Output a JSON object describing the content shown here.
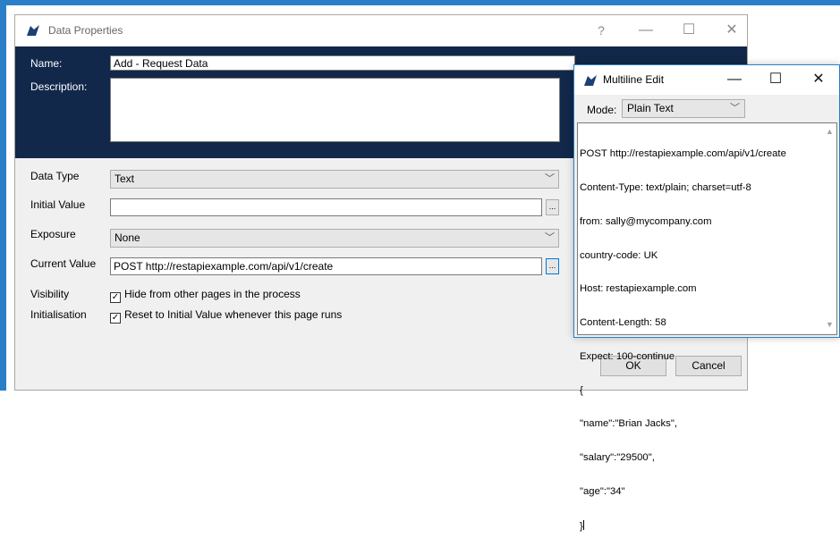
{
  "window": {
    "title": "Data Properties",
    "help_glyph": "?",
    "min_glyph": "—",
    "max_glyph": "☐",
    "close_glyph": "✕"
  },
  "header": {
    "name_label": "Name:",
    "name_value": "Add - Request Data",
    "description_label": "Description:",
    "description_value": ""
  },
  "form": {
    "data_type_label": "Data Type",
    "data_type_value": "Text",
    "initial_value_label": "Initial Value",
    "initial_value_value": "",
    "exposure_label": "Exposure",
    "exposure_value": "None",
    "current_value_label": "Current Value",
    "current_value_value": "POST http://restapiexample.com/api/v1/create",
    "ellipsis": "...",
    "visibility_label": "Visibility",
    "visibility_check": "Hide from other pages in the process",
    "initialisation_label": "Initialisation",
    "initialisation_check": "Reset to Initial Value whenever this page runs"
  },
  "buttons": {
    "ok": "OK",
    "cancel": "Cancel"
  },
  "multiline": {
    "title": "Multiline Edit",
    "min_glyph": "—",
    "max_glyph": "☐",
    "close_glyph": "✕",
    "mode_label": "Mode:",
    "mode_value": "Plain Text",
    "lines": [
      "POST http://restapiexample.com/api/v1/create",
      "Content-Type: text/plain; charset=utf-8",
      "from: sally@mycompany.com",
      "country-code: UK",
      "Host: restapiexample.com",
      "Content-Length: 58",
      "Expect: 100-continue",
      "{",
      "\"name\":\"Brian Jacks\",",
      "\"salary\":\"29500\",",
      "\"age\":\"34\"",
      "}"
    ]
  },
  "colors": {
    "header_panel": "#11284a",
    "accent": "#2b7fc8"
  }
}
